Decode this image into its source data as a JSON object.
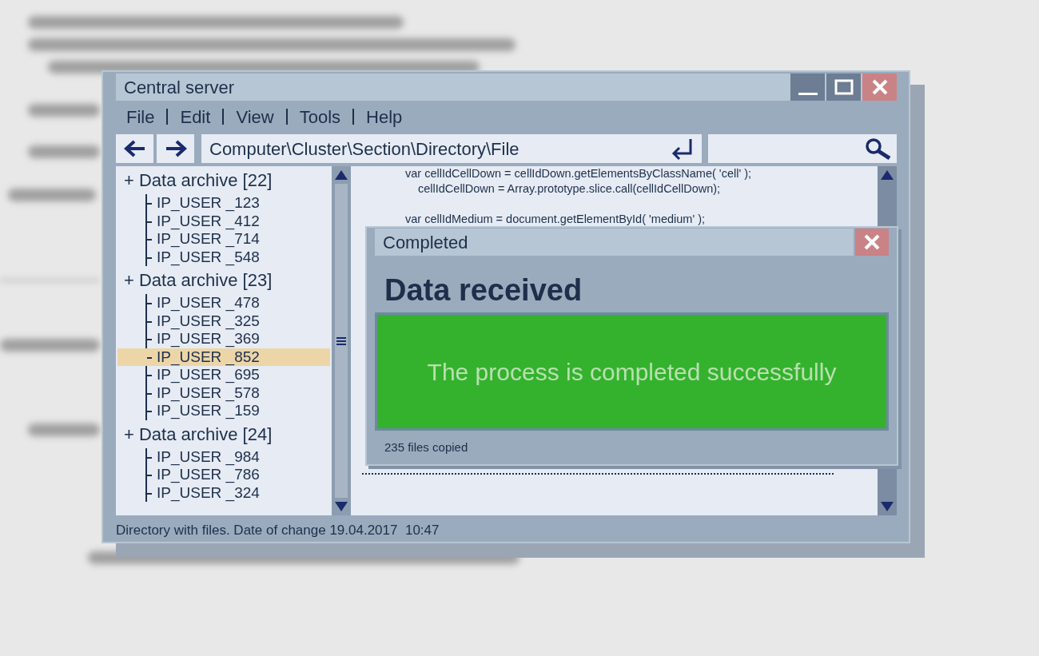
{
  "window": {
    "title": "Central server"
  },
  "menu": [
    {
      "label": "File"
    },
    {
      "label": "Edit"
    },
    {
      "label": "View"
    },
    {
      "label": "Tools"
    },
    {
      "label": "Help"
    }
  ],
  "address": {
    "value": "Computer\\Cluster\\Section\\Directory\\File"
  },
  "tree": [
    {
      "toggle": "+",
      "label": "Data archive [22]",
      "children": [
        {
          "label": "IP_USER _123",
          "selected": false
        },
        {
          "label": "IP_USER _412",
          "selected": false
        },
        {
          "label": "IP_USER _714",
          "selected": false
        },
        {
          "label": "IP_USER _548",
          "selected": false
        }
      ]
    },
    {
      "toggle": "+",
      "label": "Data archive [23]",
      "children": [
        {
          "label": "IP_USER _478",
          "selected": false
        },
        {
          "label": "IP_USER _325",
          "selected": false
        },
        {
          "label": "IP_USER _369",
          "selected": false
        },
        {
          "label": "IP_USER _852",
          "selected": true
        },
        {
          "label": "IP_USER _695",
          "selected": false
        },
        {
          "label": "IP_USER _578",
          "selected": false
        },
        {
          "label": "IP_USER _159",
          "selected": false
        }
      ]
    },
    {
      "toggle": "+",
      "label": "Data archive [24]",
      "children": [
        {
          "label": "IP_USER _984",
          "selected": false
        },
        {
          "label": "IP_USER _786",
          "selected": false
        },
        {
          "label": "IP_USER _324",
          "selected": false
        }
      ]
    }
  ],
  "code_lines": [
    {
      "text": "var cellIdCellDown = cellIdDown.getElementsByClassName( 'cell' );",
      "indent": false
    },
    {
      "text": "cellIdCellDown = Array.prototype.slice.call(cellIdCellDown);",
      "indent": true
    },
    {
      "text": "var cellIdMedium = document.getElementById( 'medium' );",
      "indent": false
    }
  ],
  "dialog": {
    "title": "Completed",
    "heading": "Data received",
    "message": "The process is completed successfully",
    "footer": "235 files copied"
  },
  "status_bar": "Directory with files. Date of change 19.04.2017  10:47"
}
